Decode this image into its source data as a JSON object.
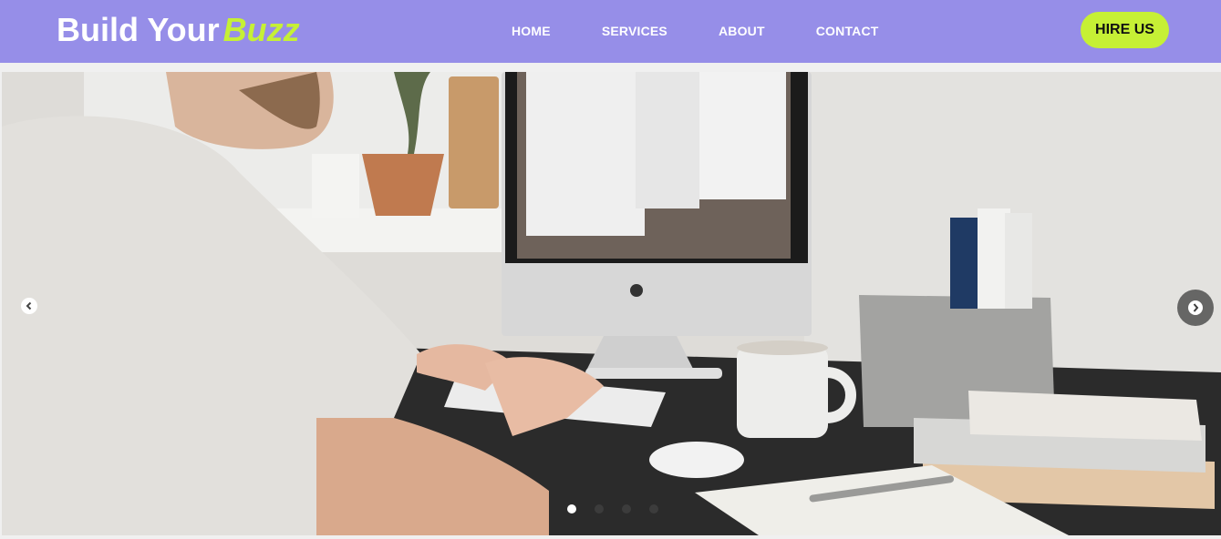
{
  "brand": {
    "main": "Build Your",
    "accent": "Buzz"
  },
  "nav": {
    "items": [
      {
        "label": "HOME"
      },
      {
        "label": "SERVICES"
      },
      {
        "label": "ABOUT"
      },
      {
        "label": "CONTACT"
      }
    ]
  },
  "cta": {
    "label": "HIRE US"
  },
  "carousel": {
    "slide_count": 4,
    "active_slide": 1
  },
  "colors": {
    "navbar": "#968ee8",
    "accent": "#c6f035",
    "text": "#ffffff"
  },
  "icons": {
    "prev": "chevron-left-icon",
    "next": "chevron-right-icon"
  }
}
